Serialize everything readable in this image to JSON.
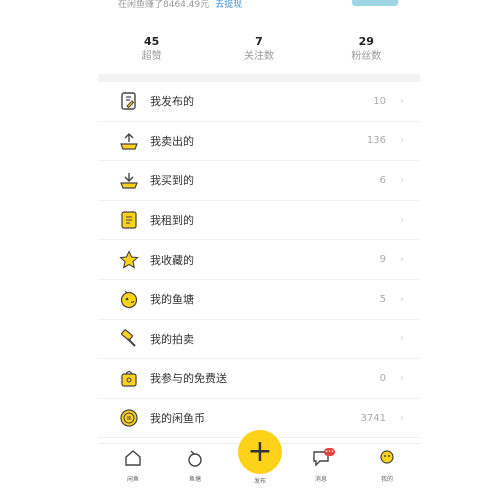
{
  "top": {
    "text": "在闲鱼赚了8464.49元",
    "link": "去提现"
  },
  "stats": [
    {
      "value": "45",
      "label": "超赞"
    },
    {
      "value": "7",
      "label": "关注数"
    },
    {
      "value": "29",
      "label": "粉丝数"
    }
  ],
  "menu": [
    {
      "label": "我发布的",
      "count": "10",
      "icon": "publish-icon"
    },
    {
      "label": "我卖出的",
      "count": "136",
      "icon": "sold-icon"
    },
    {
      "label": "我买到的",
      "count": "6",
      "icon": "bought-icon"
    },
    {
      "label": "我租到的",
      "count": "",
      "icon": "rent-icon"
    },
    {
      "label": "我收藏的",
      "count": "9",
      "icon": "star-icon"
    },
    {
      "label": "我的鱼塘",
      "count": "5",
      "icon": "fishpond-icon"
    },
    {
      "label": "我的拍卖",
      "count": "",
      "icon": "auction-icon"
    },
    {
      "label": "我参与的免费送",
      "count": "0",
      "icon": "gift-icon"
    },
    {
      "label": "我的闲鱼币",
      "count": "3741",
      "icon": "coin-icon"
    }
  ],
  "tabs": {
    "home": "闲鱼",
    "fishpond": "鱼塘",
    "publish_symbol": "+",
    "publish": "发布",
    "messages": "消息",
    "messages_badge": "•••",
    "me": "我的"
  },
  "colors": {
    "accent": "#ffd21a",
    "badge": "#e64340",
    "link": "#3b8fd9"
  }
}
